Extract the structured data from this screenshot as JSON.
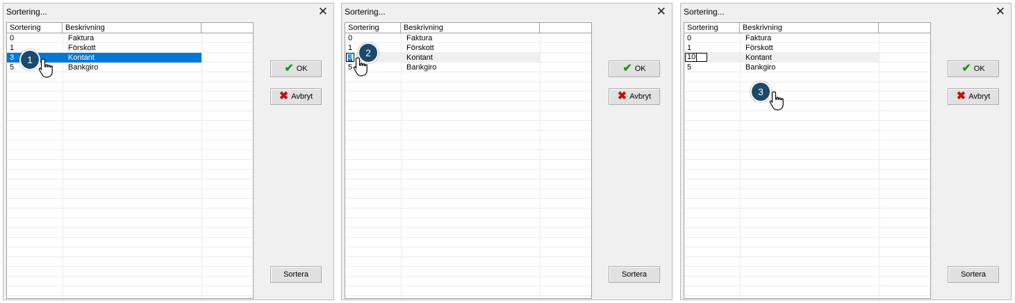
{
  "dialogs": [
    {
      "title": "Sortering...",
      "columns": [
        "Sortering",
        "Beskrivning"
      ],
      "rows": [
        {
          "order": "0",
          "description": "Faktura"
        },
        {
          "order": "1",
          "description": "Förskott"
        },
        {
          "order": "3",
          "description": "Kontant"
        },
        {
          "order": "5",
          "description": "Bankgiro"
        }
      ],
      "ok_label": "OK",
      "cancel_label": "Avbryt",
      "sort_label": "Sortera",
      "step_number": "1"
    },
    {
      "title": "Sortering...",
      "columns": [
        "Sortering",
        "Beskrivning"
      ],
      "rows": [
        {
          "order": "0",
          "description": "Faktura"
        },
        {
          "order": "1",
          "description": "Förskott"
        },
        {
          "order": "3",
          "description": "Kontant"
        },
        {
          "order": "5",
          "description": "Bankgiro"
        }
      ],
      "ok_label": "OK",
      "cancel_label": "Avbryt",
      "sort_label": "Sortera",
      "step_number": "2"
    },
    {
      "title": "Sortering...",
      "columns": [
        "Sortering",
        "Beskrivning"
      ],
      "rows": [
        {
          "order": "0",
          "description": "Faktura"
        },
        {
          "order": "1",
          "description": "Förskott"
        },
        {
          "order": "10",
          "description": "Kontant"
        },
        {
          "order": "5",
          "description": "Bankgiro"
        }
      ],
      "ok_label": "OK",
      "cancel_label": "Avbryt",
      "sort_label": "Sortera",
      "step_number": "3"
    }
  ],
  "icons": {
    "ok": "checkmark-icon",
    "cancel": "x-icon",
    "close": "close-icon",
    "pointer": "hand-pointer-icon"
  },
  "colors": {
    "selection": "#0078d7",
    "marker": "#1b4a6b",
    "ok_icon": "#1a9a1a",
    "cancel_icon": "#c01010"
  }
}
